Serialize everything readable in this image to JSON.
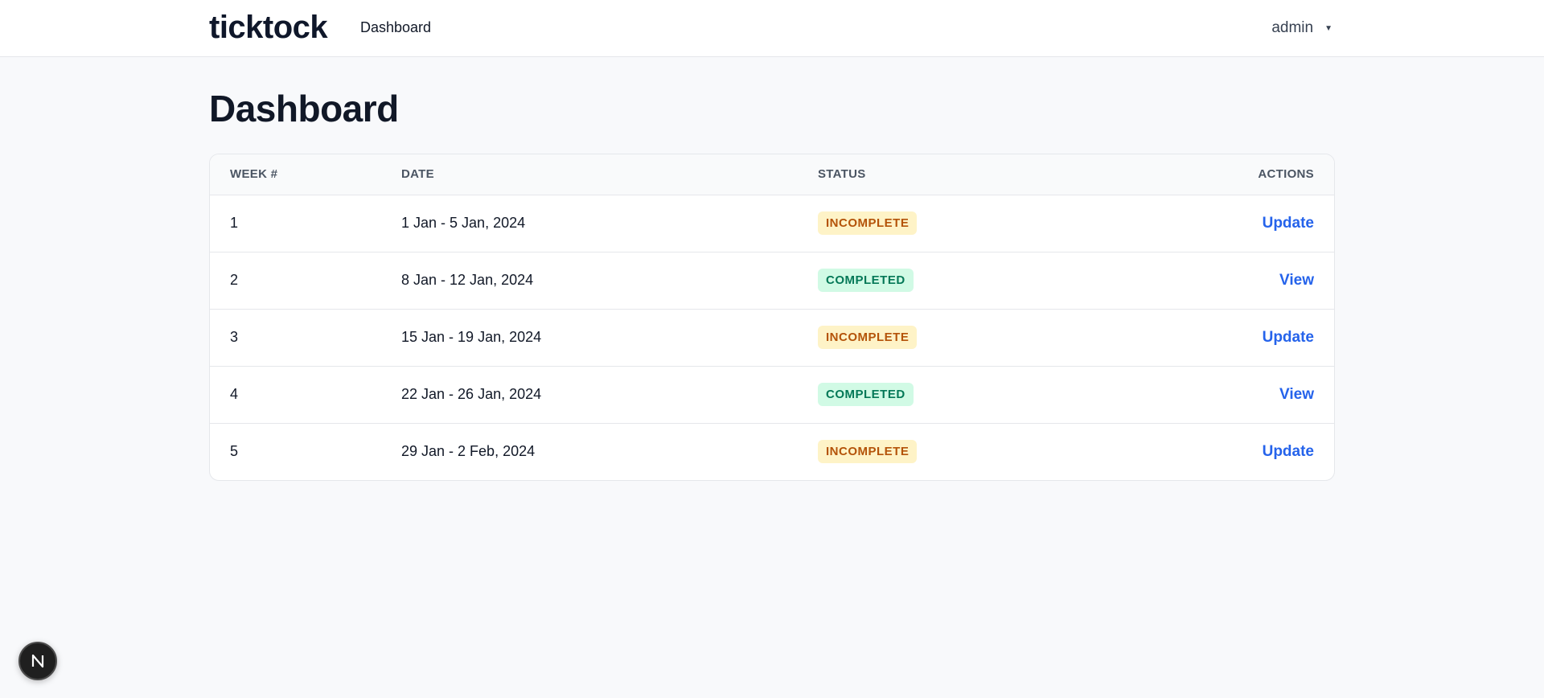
{
  "header": {
    "brand": "ticktock",
    "nav": {
      "dashboard_label": "Dashboard"
    },
    "user": {
      "name": "admin",
      "caret": "▼"
    }
  },
  "page": {
    "title": "Dashboard"
  },
  "table": {
    "columns": {
      "week": "WEEK #",
      "date": "DATE",
      "status": "STATUS",
      "actions": "ACTIONS"
    },
    "rows": [
      {
        "week": "1",
        "date": "1 Jan - 5 Jan, 2024",
        "status": "INCOMPLETE",
        "status_type": "incomplete",
        "action": "Update"
      },
      {
        "week": "2",
        "date": "8 Jan - 12 Jan, 2024",
        "status": "COMPLETED",
        "status_type": "completed",
        "action": "View"
      },
      {
        "week": "3",
        "date": "15 Jan - 19 Jan, 2024",
        "status": "INCOMPLETE",
        "status_type": "incomplete",
        "action": "Update"
      },
      {
        "week": "4",
        "date": "22 Jan - 26 Jan, 2024",
        "status": "COMPLETED",
        "status_type": "completed",
        "action": "View"
      },
      {
        "week": "5",
        "date": "29 Jan - 2 Feb, 2024",
        "status": "INCOMPLETE",
        "status_type": "incomplete",
        "action": "Update"
      }
    ]
  },
  "dev_badge": {
    "icon": "nextjs-logo-icon"
  },
  "colors": {
    "accent": "#2563eb",
    "incomplete_bg": "#fef3c7",
    "incomplete_text": "#b45309",
    "completed_bg": "#d1fae5",
    "completed_text": "#047857"
  }
}
